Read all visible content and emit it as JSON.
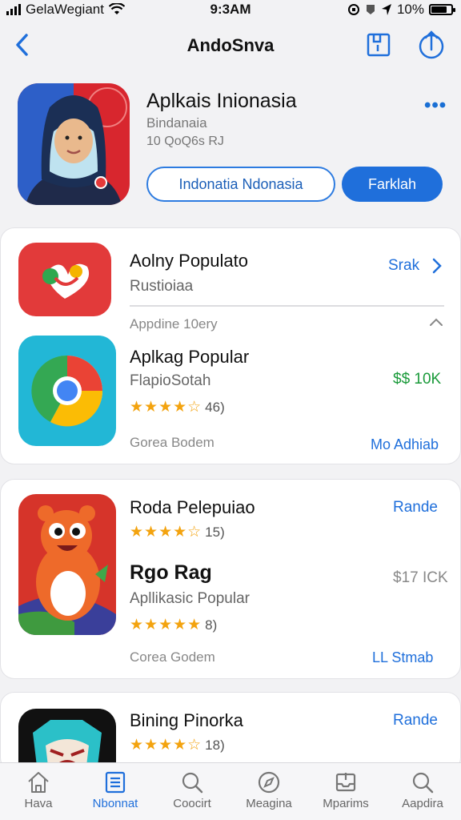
{
  "status_bar": {
    "carrier": "GelaWegiant",
    "time": "9:3AM",
    "battery": "10%"
  },
  "nav": {
    "title": "AndoSnva",
    "back_icon": "chevron-left-icon",
    "action_icons": [
      "save-icon",
      "share-icon"
    ]
  },
  "hero": {
    "name": "Aplkais Inionasia",
    "subtitle": "Bindanaia",
    "meta": "10 QoQ6s RJ",
    "more_label": "•••",
    "primary_button": "Indonatia Ndonasia",
    "secondary_button": "Farklah"
  },
  "card1": {
    "app1": {
      "title": "Aolny Populato",
      "subtitle": "Rustioiaa",
      "link": "Srak"
    },
    "section_label": "Appdine 10ery",
    "app2": {
      "title": "Aplkag Popular",
      "subtitle": "FlapioSotah",
      "price": "$$ 10K",
      "rating_count": "46)",
      "rating": 4.5
    },
    "footer_left": "Gorea Bodem",
    "footer_right": "Mo Adhiab"
  },
  "card2": {
    "app1": {
      "title": "Roda Pelepuiao",
      "rating_count": "15)",
      "rating": 4.5,
      "link": "Rande"
    },
    "app2": {
      "title": "Rgo Rag",
      "subtitle": "Apllikasic Popular",
      "price": "$17 ICK",
      "rating_count": "8)",
      "rating": 5
    },
    "footer_left": "Corea Godem",
    "footer_right": "LL Stmab"
  },
  "card3": {
    "app1": {
      "title": "Bining Pinorka",
      "rating_count": "18)",
      "rating": 4.5,
      "link": "Rande"
    }
  },
  "tabbar": {
    "tabs": [
      {
        "label": "Hava",
        "icon": "home-icon"
      },
      {
        "label": "Nbonnat",
        "icon": "list-icon",
        "active": true
      },
      {
        "label": "Coocirt",
        "icon": "search-icon"
      },
      {
        "label": "Meagina",
        "icon": "compass-icon"
      },
      {
        "label": "Mparims",
        "icon": "tray-icon"
      },
      {
        "label": "Aapdira",
        "icon": "search-icon"
      }
    ]
  },
  "colors": {
    "accent": "#1f6fdb",
    "price_green": "#1a9a3a",
    "star": "#f3a30f"
  }
}
